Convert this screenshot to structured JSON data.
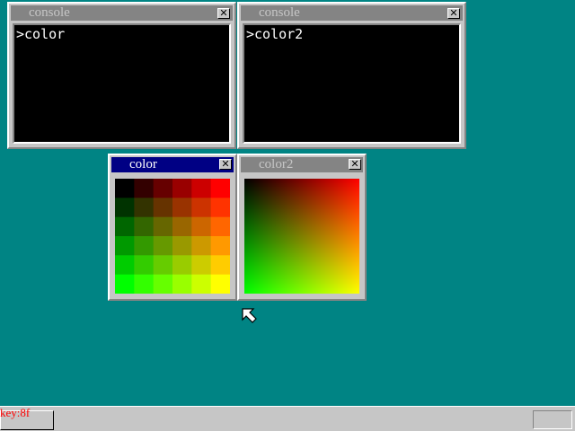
{
  "windows": {
    "console1": {
      "title": "console",
      "text": ">color",
      "close": "✕"
    },
    "console2": {
      "title": "console",
      "text": ">color2",
      "close": "✕"
    },
    "color": {
      "title": "color",
      "close": "✕"
    },
    "color2": {
      "title": "color2",
      "close": "✕"
    }
  },
  "taskbar": {
    "key_status": "key:8f"
  },
  "colors": {
    "desktop": "#008484",
    "window_face": "#c6c6c6",
    "active_title": "#000084",
    "inactive_title": "#848484"
  },
  "cursor_icon": "arrow-pointer-icon"
}
